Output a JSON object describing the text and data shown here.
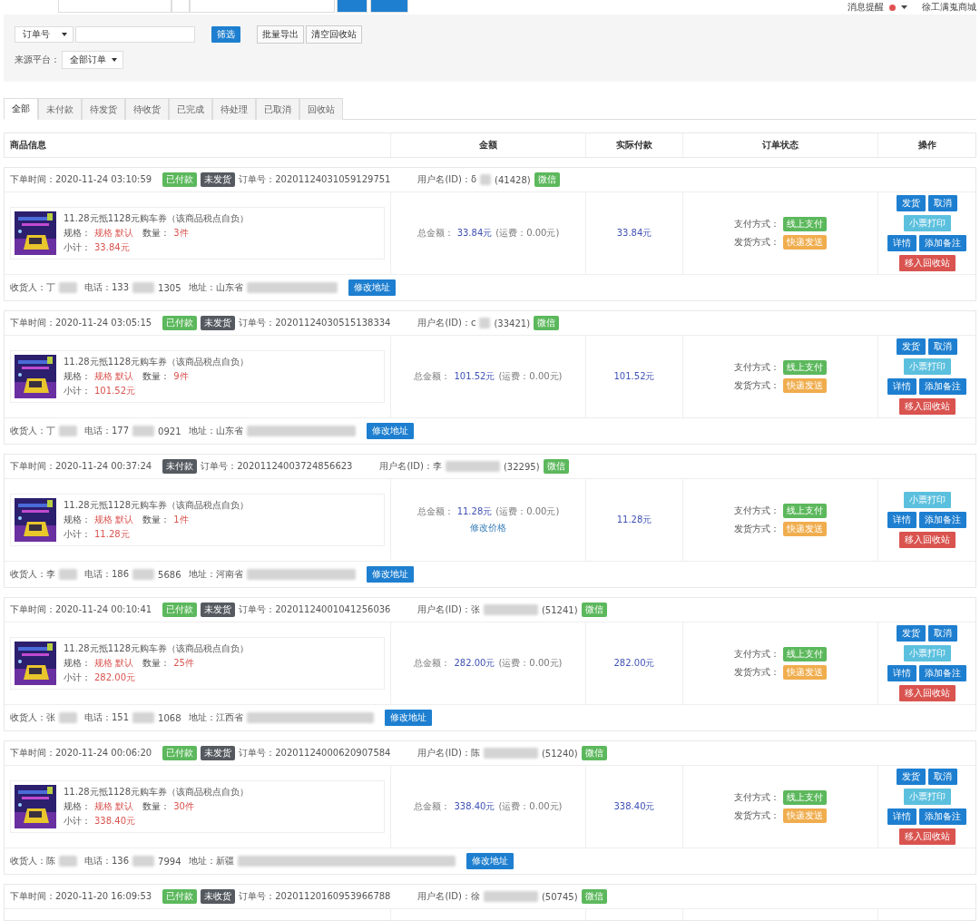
{
  "topbar": {
    "notice": "消息提醒",
    "shop": "徐工满嵬商城"
  },
  "filter": {
    "search_type": "订单号",
    "search_button": "筛选",
    "export_button": "批量导出",
    "clear_button": "清空回收站",
    "source_label": "来源平台：",
    "source_value": "全部订单"
  },
  "tabs": [
    {
      "label": "全部",
      "selected": true
    },
    {
      "label": "未付款",
      "selected": false
    },
    {
      "label": "待发货",
      "selected": false
    },
    {
      "label": "待收货",
      "selected": false
    },
    {
      "label": "已完成",
      "selected": false
    },
    {
      "label": "待处理",
      "selected": false
    },
    {
      "label": "已取消",
      "selected": false
    },
    {
      "label": "回收站",
      "selected": false
    }
  ],
  "table": {
    "columns": [
      "商品信息",
      "金额",
      "实际付款",
      "订单状态",
      "操作"
    ],
    "orders": [
      {
        "time": "下单时间：2020-11-24 03:10:59",
        "badges": [
          {
            "text": "已付款",
            "color": "#5cb85c"
          },
          {
            "text": "未发货",
            "color": "#555a60"
          }
        ],
        "order_no": "订单号：20201124031059129751",
        "user": "用户名(ID)：δ",
        "user_id": "(41428)",
        "channel": "微信",
        "product": {
          "title": "11.28元抵1128元购车券（该商品税点自负）",
          "spec_label": "规格：",
          "spec": "规格 默认",
          "qty_label": "数量：",
          "qty": "3件",
          "subtotal_label": "小计：",
          "subtotal": "33.84元"
        },
        "total_label": "总金额：",
        "total": "33.84元",
        "freight": "(运费：0.00元)",
        "paid": "33.84元",
        "pay_label": "支付方式：",
        "pay": "线上支付",
        "ship_label": "发货方式：",
        "ship": "快递发送",
        "actions": [
          [
            {
              "text": "发货",
              "kind": "primary"
            },
            {
              "text": "取消",
              "kind": "primary"
            }
          ],
          [
            {
              "text": "小票打印",
              "kind": "info"
            }
          ],
          [
            {
              "text": "详情",
              "kind": "primary"
            },
            {
              "text": "添加备注",
              "kind": "primary"
            }
          ],
          [
            {
              "text": "移入回收站",
              "kind": "danger"
            }
          ]
        ],
        "receiver": "收货人：丁",
        "phone_start": "电话：133",
        "phone_end": "1305",
        "address": "地址：山东省",
        "address_button": "修改地址"
      },
      {
        "time": "下单时间：2020-11-24 03:05:15",
        "badges": [
          {
            "text": "已付款",
            "color": "#5cb85c"
          },
          {
            "text": "未发货",
            "color": "#555a60"
          }
        ],
        "order_no": "订单号：20201124030515138334",
        "user": "用户名(ID)：c",
        "user_id": "(33421)",
        "channel": "微信",
        "product": {
          "title": "11.28元抵1128元购车券（该商品税点自负）",
          "spec_label": "规格：",
          "spec": "规格 默认",
          "qty_label": "数量：",
          "qty": "9件",
          "subtotal_label": "小计：",
          "subtotal": "101.52元"
        },
        "total_label": "总金额：",
        "total": "101.52元",
        "freight": "(运费：0.00元)",
        "paid": "101.52元",
        "pay_label": "支付方式：",
        "pay": "线上支付",
        "ship_label": "发货方式：",
        "ship": "快递发送",
        "actions": [
          [
            {
              "text": "发货",
              "kind": "primary"
            },
            {
              "text": "取消",
              "kind": "primary"
            }
          ],
          [
            {
              "text": "小票打印",
              "kind": "info"
            }
          ],
          [
            {
              "text": "详情",
              "kind": "primary"
            },
            {
              "text": "添加备注",
              "kind": "primary"
            }
          ],
          [
            {
              "text": "移入回收站",
              "kind": "danger"
            }
          ]
        ],
        "receiver": "收货人：丁",
        "phone_start": "电话：177",
        "phone_end": "0921",
        "address": "地址：山东省",
        "address_button": "修改地址"
      },
      {
        "time": "下单时间：2020-11-24 00:37:24",
        "badges": [
          {
            "text": "未付款",
            "color": "#555a60"
          }
        ],
        "order_no": "订单号：20201124003724856623",
        "user": "用户名(ID)：李",
        "user_id": "(32295)",
        "channel": "微信",
        "product": {
          "title": "11.28元抵1128元购车券（该商品税点自负）",
          "spec_label": "规格：",
          "spec": "规格 默认",
          "qty_label": "数量：",
          "qty": "1件",
          "subtotal_label": "小计：",
          "subtotal": "11.28元"
        },
        "total_label": "总金额：",
        "total": "11.28元",
        "freight": "(运费：0.00元)",
        "price_link": "修改价格",
        "paid": "11.28元",
        "pay_label": "支付方式：",
        "pay": "线上支付",
        "ship_label": "发货方式：",
        "ship": "快递发送",
        "actions": [
          [
            {
              "text": "小票打印",
              "kind": "info"
            }
          ],
          [
            {
              "text": "详情",
              "kind": "primary"
            },
            {
              "text": "添加备注",
              "kind": "primary"
            }
          ],
          [
            {
              "text": "移入回收站",
              "kind": "danger"
            }
          ]
        ],
        "receiver": "收货人：李",
        "phone_start": "电话：186",
        "phone_end": "5686",
        "address": "地址：河南省",
        "address_button": "修改地址"
      },
      {
        "time": "下单时间：2020-11-24 00:10:41",
        "badges": [
          {
            "text": "已付款",
            "color": "#5cb85c"
          },
          {
            "text": "未发货",
            "color": "#555a60"
          }
        ],
        "order_no": "订单号：20201124001041256036",
        "user": "用户名(ID)：张",
        "user_id": "(51241)",
        "channel": "微信",
        "product": {
          "title": "11.28元抵1128元购车券（该商品税点自负）",
          "spec_label": "规格：",
          "spec": "规格 默认",
          "qty_label": "数量：",
          "qty": "25件",
          "subtotal_label": "小计：",
          "subtotal": "282.00元"
        },
        "total_label": "总金额：",
        "total": "282.00元",
        "freight": "(运费：0.00元)",
        "paid": "282.00元",
        "pay_label": "支付方式：",
        "pay": "线上支付",
        "ship_label": "发货方式：",
        "ship": "快递发送",
        "actions": [
          [
            {
              "text": "发货",
              "kind": "primary"
            },
            {
              "text": "取消",
              "kind": "primary"
            }
          ],
          [
            {
              "text": "小票打印",
              "kind": "info"
            }
          ],
          [
            {
              "text": "详情",
              "kind": "primary"
            },
            {
              "text": "添加备注",
              "kind": "primary"
            }
          ],
          [
            {
              "text": "移入回收站",
              "kind": "danger"
            }
          ]
        ],
        "receiver": "收货人：张",
        "phone_start": "电话：151",
        "phone_end": "1068",
        "address": "地址：江西省",
        "address_button": "修改地址"
      },
      {
        "time": "下单时间：2020-11-24 00:06:20",
        "badges": [
          {
            "text": "已付款",
            "color": "#5cb85c"
          },
          {
            "text": "未发货",
            "color": "#555a60"
          }
        ],
        "order_no": "订单号：20201124000620907584",
        "user": "用户名(ID)：陈",
        "user_id": "(51240)",
        "channel": "微信",
        "product": {
          "title": "11.28元抵1128元购车券（该商品税点自负）",
          "spec_label": "规格：",
          "spec": "规格 默认",
          "qty_label": "数量：",
          "qty": "30件",
          "subtotal_label": "小计：",
          "subtotal": "338.40元"
        },
        "total_label": "总金额：",
        "total": "338.40元",
        "freight": "(运费：0.00元)",
        "paid": "338.40元",
        "pay_label": "支付方式：",
        "pay": "线上支付",
        "ship_label": "发货方式：",
        "ship": "快递发送",
        "actions": [
          [
            {
              "text": "发货",
              "kind": "primary"
            },
            {
              "text": "取消",
              "kind": "primary"
            }
          ],
          [
            {
              "text": "小票打印",
              "kind": "info"
            }
          ],
          [
            {
              "text": "详情",
              "kind": "primary"
            },
            {
              "text": "添加备注",
              "kind": "primary"
            }
          ],
          [
            {
              "text": "移入回收站",
              "kind": "danger"
            }
          ]
        ],
        "receiver": "收货人：陈",
        "phone_start": "电话：136",
        "phone_end": "7994",
        "address": "地址：新疆",
        "address_button": "修改地址"
      },
      {
        "time": "下单时间：2020-11-20 16:09:53",
        "badges": [
          {
            "text": "已付款",
            "color": "#5cb85c"
          },
          {
            "text": "未收货",
            "color": "#555a60"
          }
        ],
        "order_no": "订单号：20201120160953966788",
        "user": "用户名(ID)：徐",
        "user_id": "(50745)",
        "channel": "微信"
      }
    ]
  }
}
